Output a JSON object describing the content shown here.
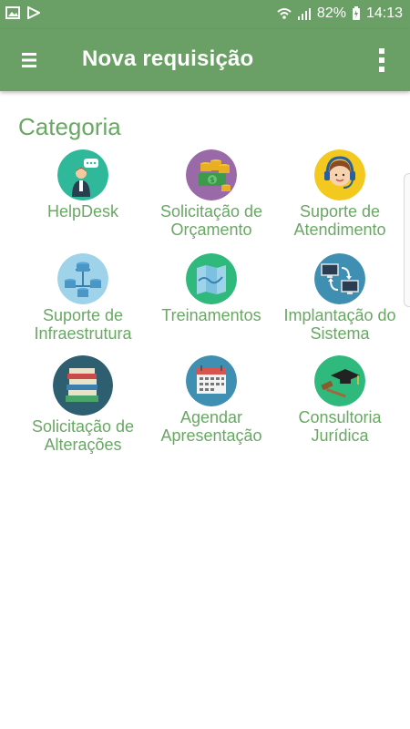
{
  "status_bar": {
    "battery": "82%",
    "time": "14:13",
    "icons": [
      "gallery-icon",
      "play-store-icon",
      "wifi-icon",
      "signal-icon",
      "battery-icon"
    ]
  },
  "app_bar": {
    "title": "Nova requisição",
    "menu_icon": "hamburger-menu-icon",
    "more_icon": "more-vertical-icon",
    "color": "#6aa066"
  },
  "section": {
    "title": "Categoria"
  },
  "categories": [
    {
      "label_1": "HelpDesk",
      "label_2": "",
      "icon": "helpdesk-person-icon"
    },
    {
      "label_1": "Solicitação de",
      "label_2": "Orçamento",
      "icon": "money-coins-icon"
    },
    {
      "label_1": "Suporte de",
      "label_2": "Atendimento",
      "icon": "headset-agent-icon"
    },
    {
      "label_1": "Suporte de",
      "label_2": "Infraestrutura",
      "icon": "network-database-icon"
    },
    {
      "label_1": "Treinamentos",
      "label_2": "",
      "icon": "map-book-icon"
    },
    {
      "label_1": "Implantação do",
      "label_2": "Sistema",
      "icon": "computers-sync-icon"
    },
    {
      "label_1": "Solicitação de",
      "label_2": "Alterações",
      "icon": "books-stack-icon"
    },
    {
      "label_1": "Agendar",
      "label_2": "Apresentação",
      "icon": "calendar-icon"
    },
    {
      "label_1": "Consultoria",
      "label_2": "Jurídica",
      "icon": "graduation-gavel-icon"
    }
  ],
  "colors": {
    "accent_text": "#69a864"
  }
}
